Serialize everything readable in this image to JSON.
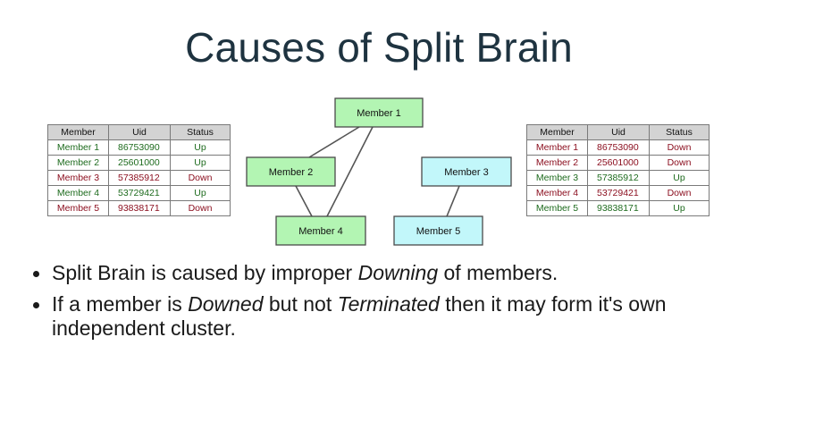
{
  "title": "Causes of Split Brain",
  "table_headers": [
    "Member",
    "Uid",
    "Status"
  ],
  "left_table": {
    "rows": [
      {
        "member": "Member 1",
        "uid": "86753090",
        "status": "Up"
      },
      {
        "member": "Member 2",
        "uid": "25601000",
        "status": "Up"
      },
      {
        "member": "Member 3",
        "uid": "57385912",
        "status": "Down"
      },
      {
        "member": "Member 4",
        "uid": "53729421",
        "status": "Up"
      },
      {
        "member": "Member 5",
        "uid": "93838171",
        "status": "Down"
      }
    ]
  },
  "right_table": {
    "rows": [
      {
        "member": "Member 1",
        "uid": "86753090",
        "status": "Down"
      },
      {
        "member": "Member 2",
        "uid": "25601000",
        "status": "Down"
      },
      {
        "member": "Member 3",
        "uid": "57385912",
        "status": "Up"
      },
      {
        "member": "Member 4",
        "uid": "53729421",
        "status": "Down"
      },
      {
        "member": "Member 5",
        "uid": "93838171",
        "status": "Up"
      }
    ]
  },
  "diagram": {
    "nodes": [
      {
        "id": "m1",
        "label": "Member 1",
        "color": "#b3f5b3"
      },
      {
        "id": "m2",
        "label": "Member 2",
        "color": "#b3f5b3"
      },
      {
        "id": "m3",
        "label": "Member 3",
        "color": "#c2f7fa"
      },
      {
        "id": "m4",
        "label": "Member 4",
        "color": "#b3f5b3"
      },
      {
        "id": "m5",
        "label": "Member 5",
        "color": "#c2f7fa"
      }
    ],
    "edges": [
      [
        "m1",
        "m2"
      ],
      [
        "m1",
        "m4"
      ],
      [
        "m2",
        "m4"
      ],
      [
        "m3",
        "m5"
      ]
    ]
  },
  "colors": {
    "up_text": "#1e6b1e",
    "down_text": "#8c1020",
    "green_node": "#b3f5b3",
    "cyan_node": "#c2f7fa"
  },
  "bullets": {
    "b1_pre": "Split Brain is caused by improper ",
    "b1_em": "Downing",
    "b1_post": " of members.",
    "b2_pre": "If a member is ",
    "b2_em1": "Downed",
    "b2_mid": " but not ",
    "b2_em2": "Terminated",
    "b2_post": " then it may form it's own independent cluster."
  }
}
